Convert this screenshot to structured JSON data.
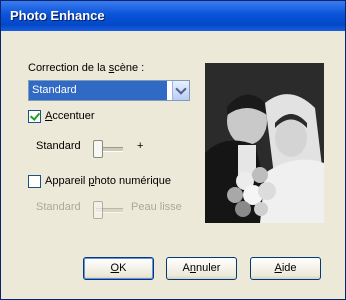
{
  "window": {
    "title": "Photo Enhance"
  },
  "scene": {
    "label_pre": "Correction de la ",
    "label_u": "s",
    "label_post": "cène :",
    "selected": "Standard"
  },
  "sharpen": {
    "checked": true,
    "label_u": "A",
    "label_rest": "ccentuer",
    "slider_left": "Standard",
    "slider_right": "+",
    "level": 0.0
  },
  "digital_camera": {
    "checked": false,
    "label_pre": "Appareil ",
    "label_u": "p",
    "label_post": "hoto numérique",
    "slider_left": "Standard",
    "slider_right": "Peau lisse",
    "level": 0.0
  },
  "buttons": {
    "ok_u": "O",
    "ok_rest": "K",
    "cancel_pre": "A",
    "cancel_u": "n",
    "cancel_post": "nuler",
    "help_u": "A",
    "help_rest": "ide"
  },
  "icons": {
    "dropdown": "chevron-down-icon",
    "check": "checkmark-icon"
  }
}
